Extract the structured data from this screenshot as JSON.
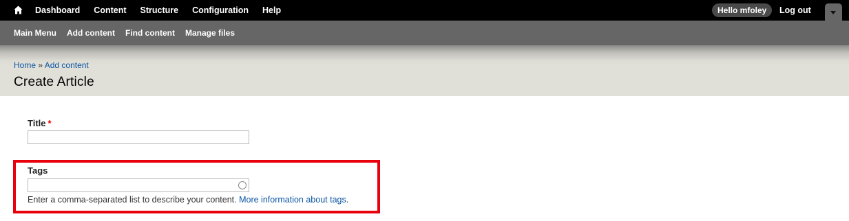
{
  "toolbar": {
    "home_icon": "home-icon",
    "menu": [
      "Dashboard",
      "Content",
      "Structure",
      "Configuration",
      "Help"
    ],
    "greeting_prefix": "Hello ",
    "username": "mfoley",
    "logout_label": "Log out",
    "drawer_icon": "chevron-down-icon"
  },
  "shortcuts": {
    "items": [
      "Main Menu",
      "Add content",
      "Find content",
      "Manage files"
    ]
  },
  "breadcrumb": {
    "items": [
      "Home",
      "Add content"
    ],
    "separator": " » "
  },
  "page_title": "Create Article",
  "form": {
    "title": {
      "label": "Title",
      "required_marker": "*",
      "value": ""
    },
    "tags": {
      "label": "Tags",
      "value": "",
      "description_text": "Enter a comma-separated list to describe your content. ",
      "description_link": "More information about tags",
      "description_end": "."
    }
  },
  "colors": {
    "toolbar_bg": "#000000",
    "shortcuts_bg": "#666666",
    "header_bg": "#e0e0d8",
    "link": "#0b55a3",
    "required": "#ee0000",
    "highlight": "#e8000c"
  }
}
